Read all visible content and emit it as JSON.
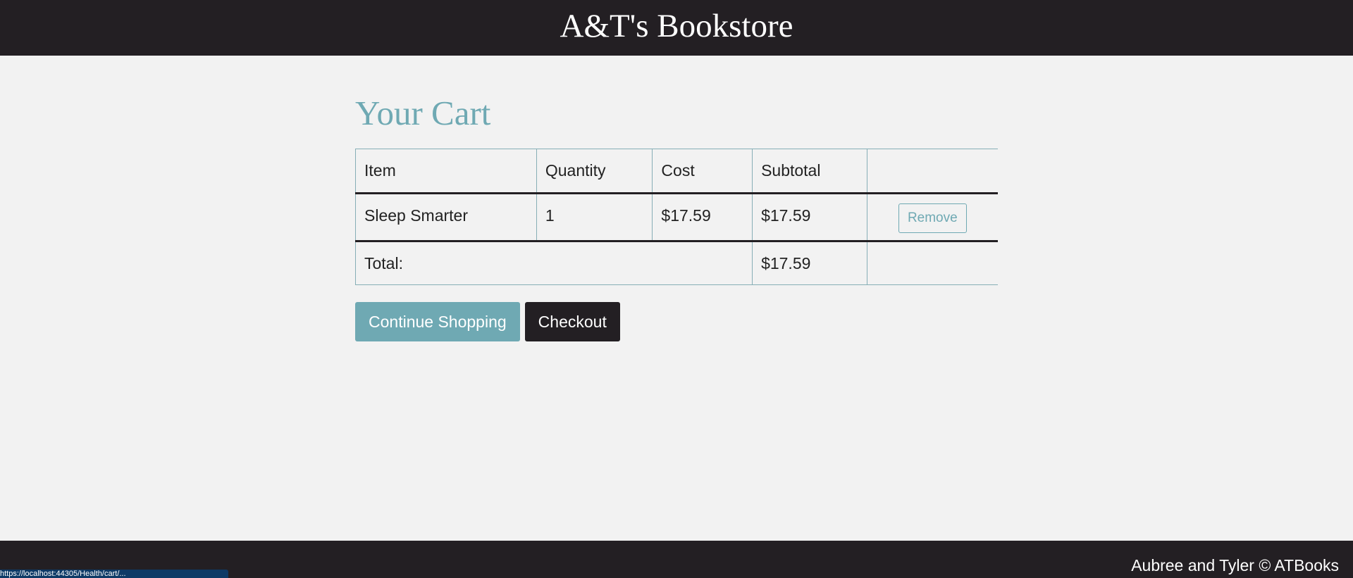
{
  "header": {
    "brand": "A&T's Bookstore"
  },
  "cart": {
    "title": "Your Cart",
    "columns": [
      "Item",
      "Quantity",
      "Cost",
      "Subtotal",
      ""
    ],
    "items": [
      {
        "name": "Sleep Smarter",
        "quantity": "1",
        "cost": "$17.59",
        "subtotal": "$17.59",
        "remove_label": "Remove"
      }
    ],
    "total_label": "Total:",
    "total_value": "$17.59"
  },
  "actions": {
    "continue_label": "Continue Shopping",
    "checkout_label": "Checkout"
  },
  "footer": {
    "copyright": "Aubree and Tyler © ATBooks"
  },
  "status_bar": {
    "url": "https://localhost:44305/Health/cart/..."
  },
  "colors": {
    "accent": "#6fa9b3",
    "dark": "#231f23",
    "background": "#f2f2f2"
  }
}
